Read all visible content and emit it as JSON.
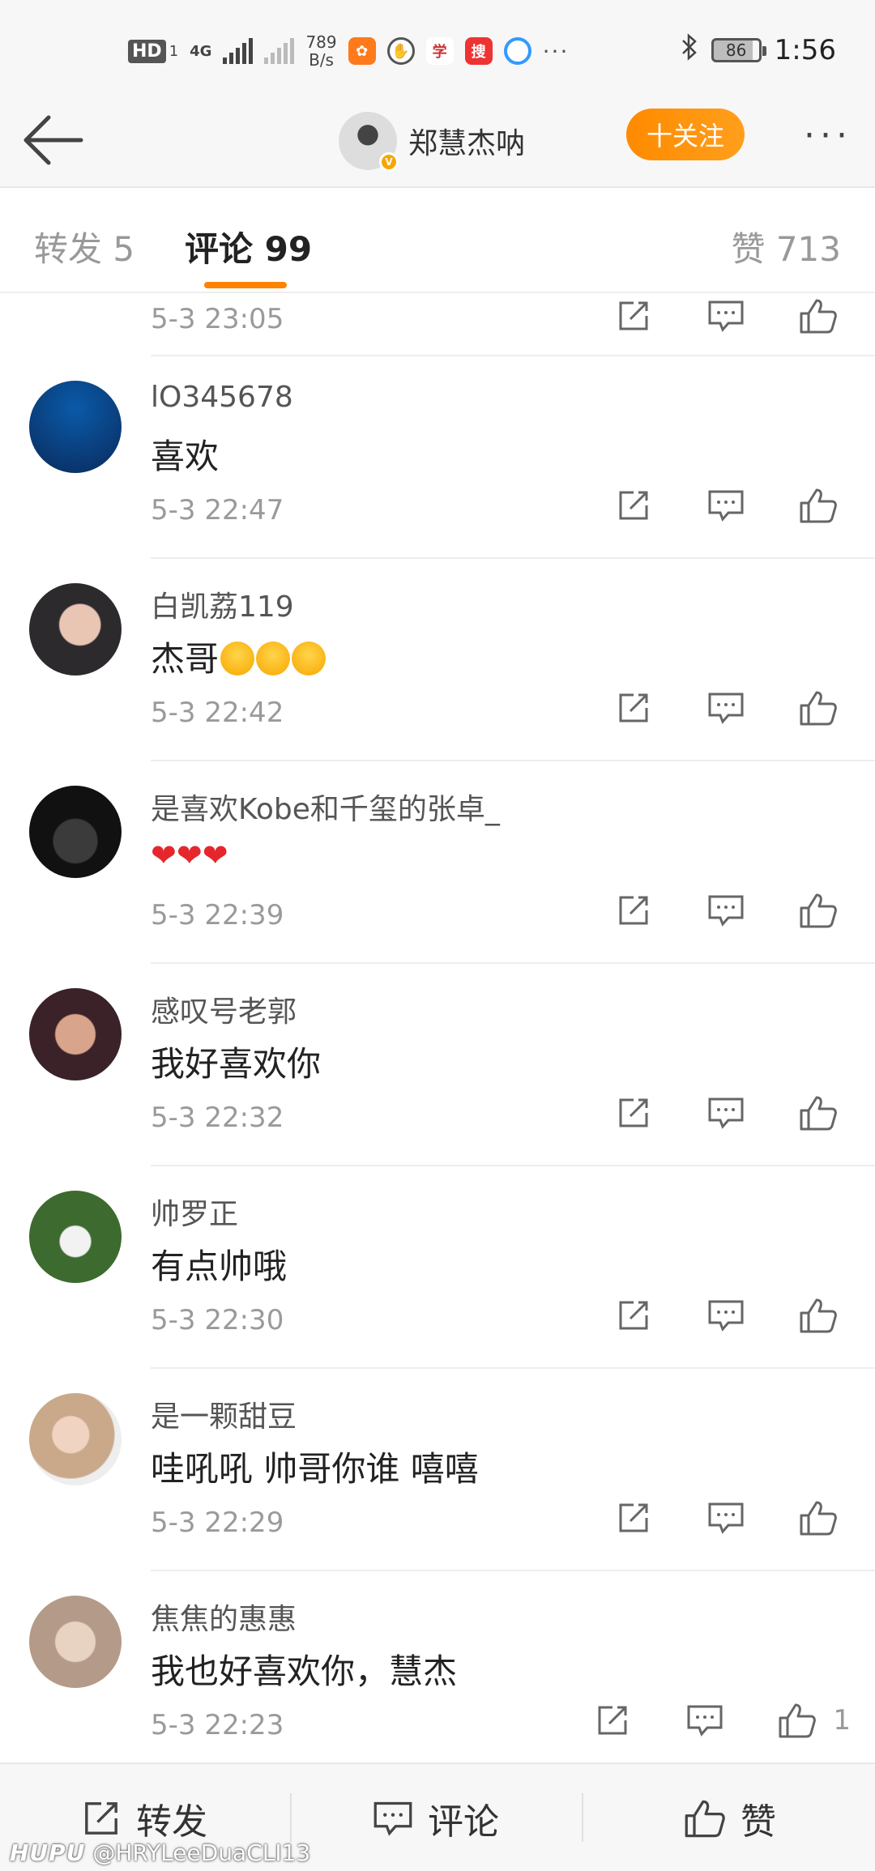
{
  "status_bar": {
    "hd": "HD",
    "hd_sub": "1",
    "network": "4G",
    "speed_value": "789",
    "speed_unit": "B/s",
    "battery": "86",
    "time": "1:56",
    "overflow": "···"
  },
  "nav": {
    "account_name": "郑慧杰呐",
    "follow_label": "十关注",
    "more_label": "···"
  },
  "tabs": {
    "repost": "转发 5",
    "comments": "评论 99",
    "likes": "赞 713"
  },
  "partial_row": {
    "time": "5-3 23:05"
  },
  "comments": [
    {
      "user": "lO345678",
      "text": "喜欢",
      "time": "5-3 22:47"
    },
    {
      "user": "白凯荔119",
      "text": "杰哥",
      "time": "5-3 22:42"
    },
    {
      "user": "是喜欢Kobe和千玺的张卓_",
      "text": "",
      "time": "5-3 22:39"
    },
    {
      "user": "感叹号老郭",
      "text": "我好喜欢你",
      "time": "5-3 22:32"
    },
    {
      "user": "帅罗正",
      "text": "有点帅哦",
      "time": "5-3 22:30"
    },
    {
      "user": "是一颗甜豆",
      "text": "哇吼吼 帅哥你谁 嘻嘻",
      "time": "5-3 22:29"
    },
    {
      "user": "焦焦的惠惠",
      "text": "我也好喜欢你，慧杰",
      "time": "5-3 22:23",
      "likes": "1"
    }
  ],
  "bottom_bar": {
    "repost": "转发",
    "comment": "评论",
    "like": "赞"
  },
  "watermark": {
    "brand": "HUPU",
    "handle": "@HRYLeeDuaCLI13"
  },
  "colors": {
    "accent": "#ff8200",
    "heart": "#e5272d"
  }
}
